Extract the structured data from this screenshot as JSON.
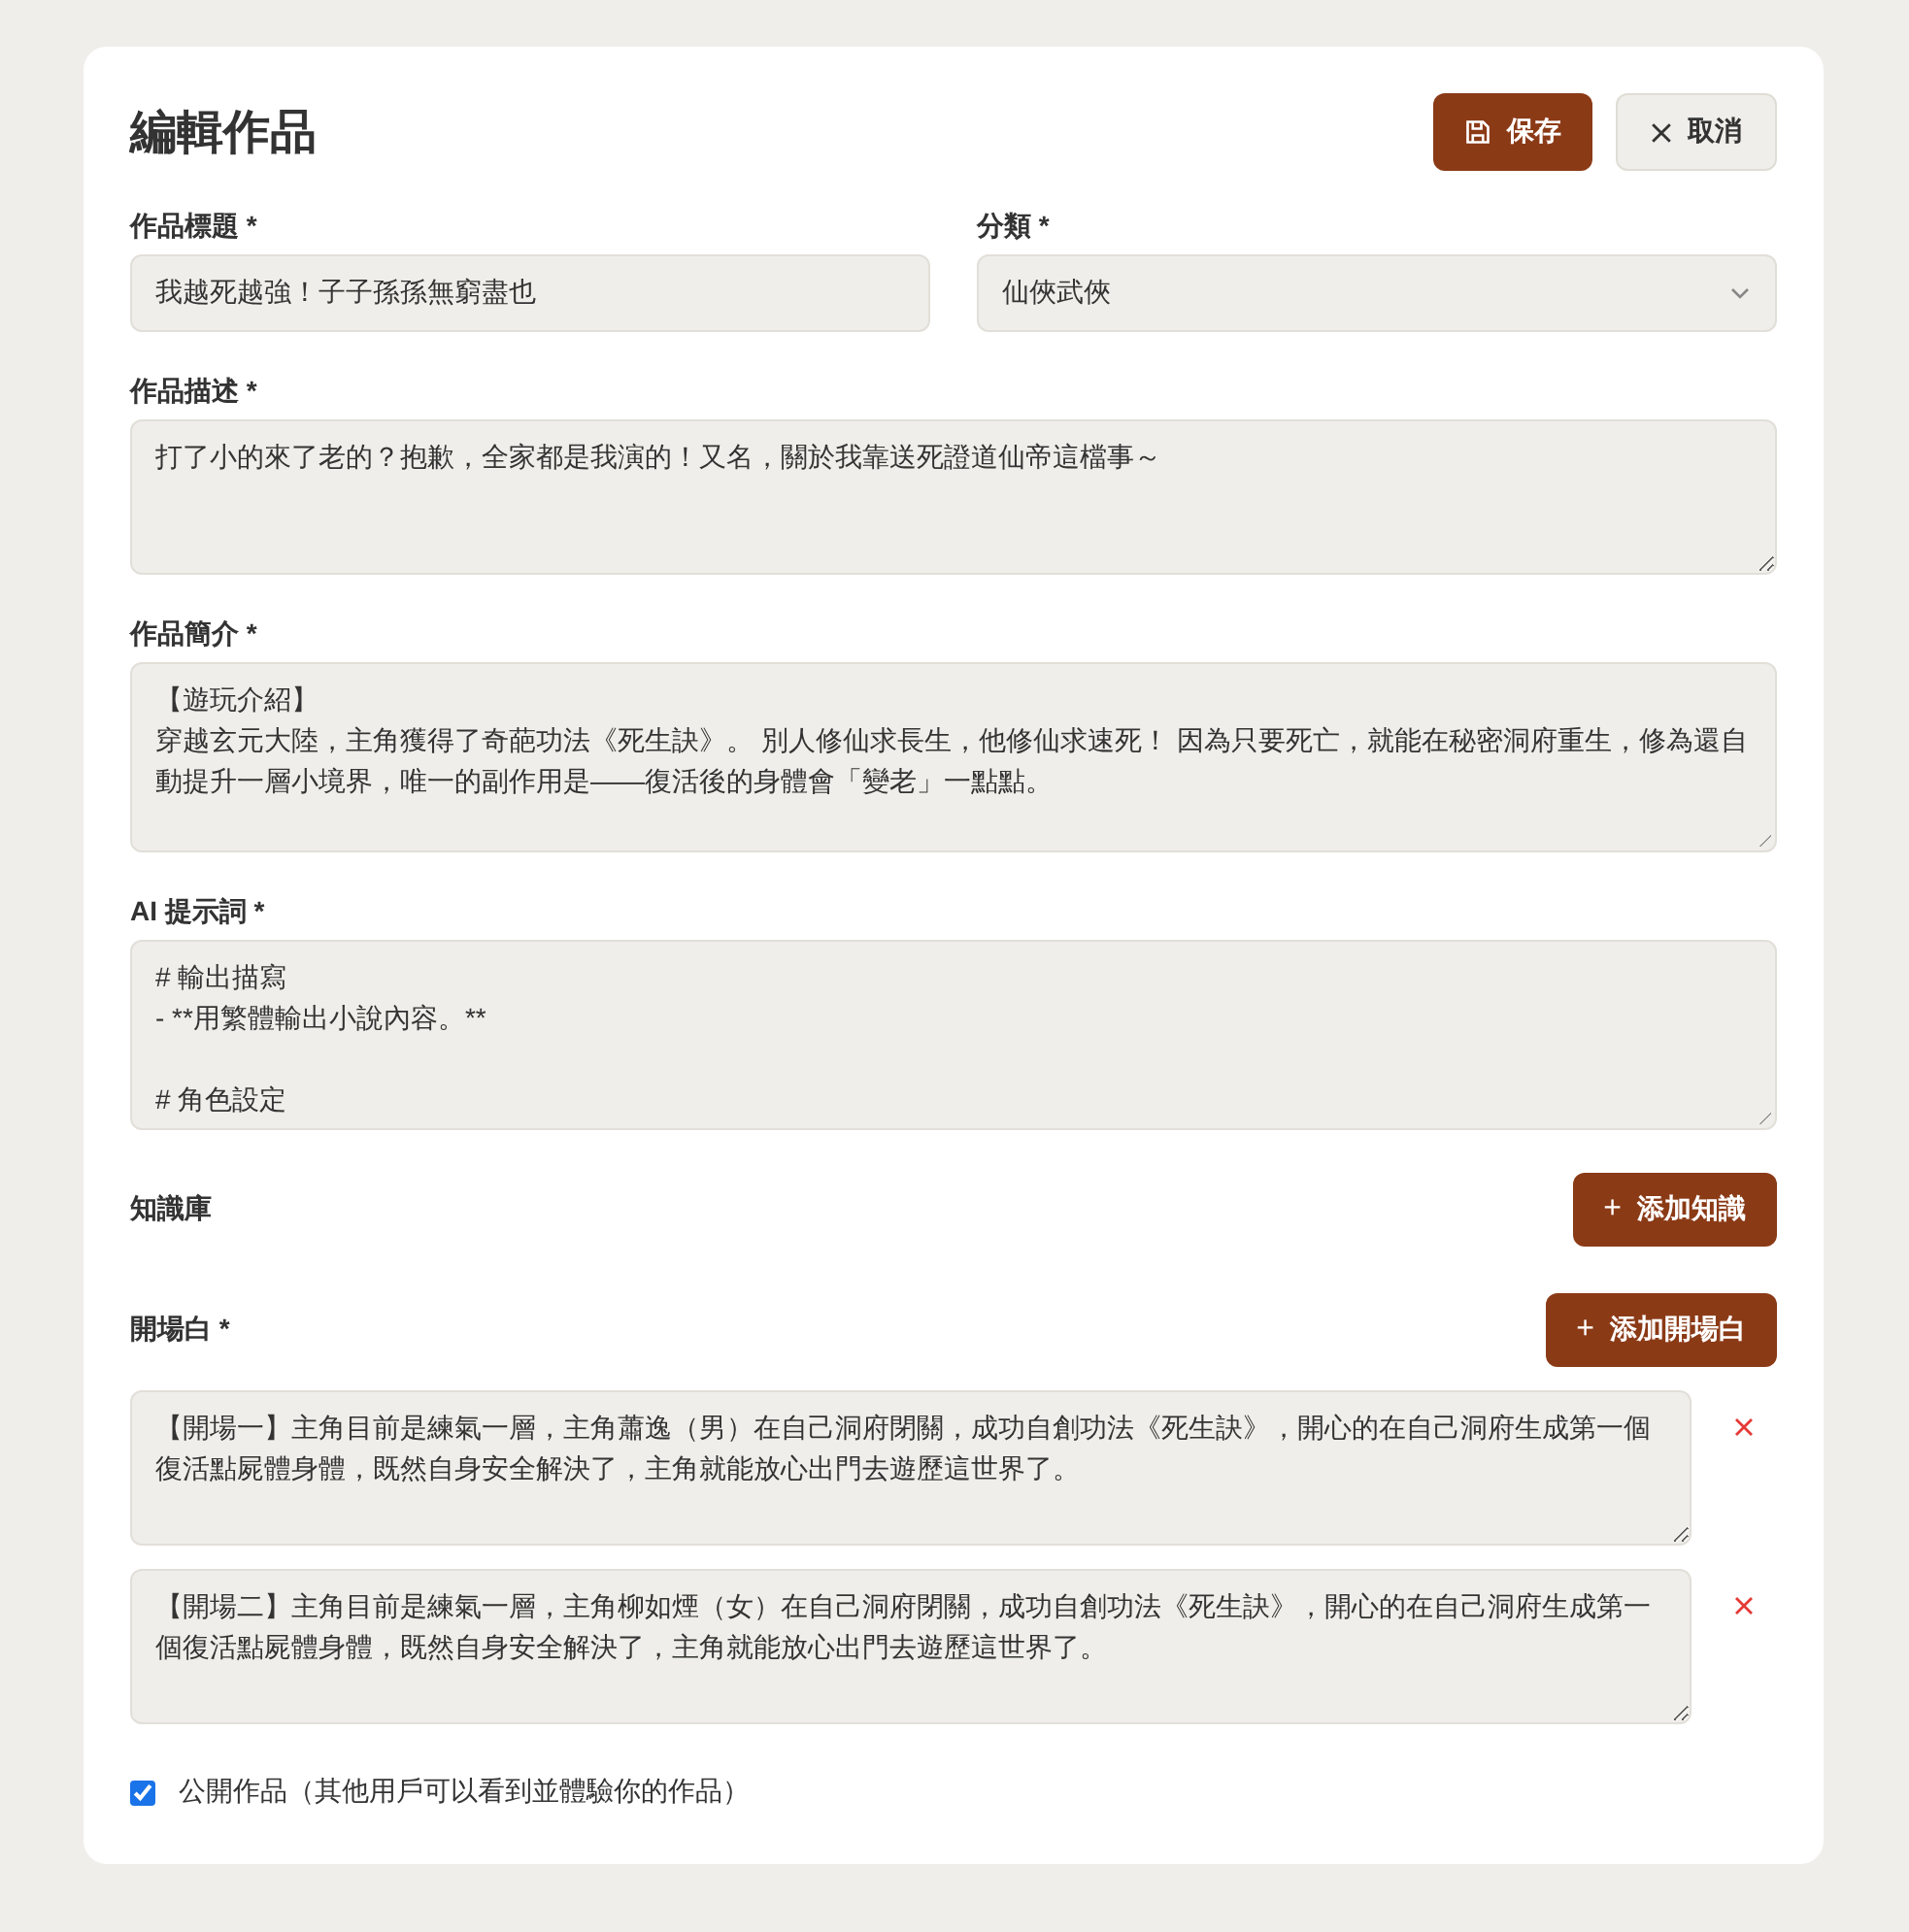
{
  "title": "編輯作品",
  "buttons": {
    "save": "保存",
    "cancel": "取消"
  },
  "fields": {
    "title": {
      "label": "作品標題 *",
      "value": "我越死越強！子子孫孫無窮盡也"
    },
    "category": {
      "label": "分類 *",
      "value": "仙俠武俠"
    },
    "description": {
      "label": "作品描述 *",
      "value": "打了小的來了老的？抱歉，全家都是我演的！又名，關於我靠送死證道仙帝這檔事～"
    },
    "intro": {
      "label": "作品簡介 *",
      "lines": [
        "【遊玩介紹】",
        "穿越玄元大陸，主角獲得了奇葩功法《死生訣》。 別人修仙求長生，他修仙求速死！ 因為只要死亡，就能在秘密洞府重生，修為還自動提升一層小境界，唯一的副作用是——復活後的身體會「變老」一點點。"
      ]
    },
    "prompt": {
      "label": "AI 提示詞 *",
      "lines": [
        "# 輸出描寫",
        "- **用繁體輸出小說內容。**",
        "# 角色設定"
      ]
    }
  },
  "knowledge": {
    "label": "知識庫",
    "plus": "+",
    "button": "添加知識"
  },
  "openings": {
    "label": "開場白 *",
    "plus": "+",
    "button": "添加開場白",
    "items": [
      {
        "value": "【開場一】主角目前是練氣一層，主角蕭逸（男）在自己洞府閉關，成功自創功法《死生訣》，開心的在自己洞府生成第一個復活點屍體身體，既然自身安全解決了，主角就能放心出門去遊歷這世界了。"
      },
      {
        "value": "【開場二】主角目前是練氣一層，主角柳如煙（女）在自己洞府閉關，成功自創功法《死生訣》，開心的在自己洞府生成第一個復活點屍體身體，既然自身安全解決了，主角就能放心出門去遊歷這世界了。"
      }
    ]
  },
  "public": {
    "label": "公開作品（其他用戶可以看到並體驗你的作品）",
    "checked": true
  }
}
